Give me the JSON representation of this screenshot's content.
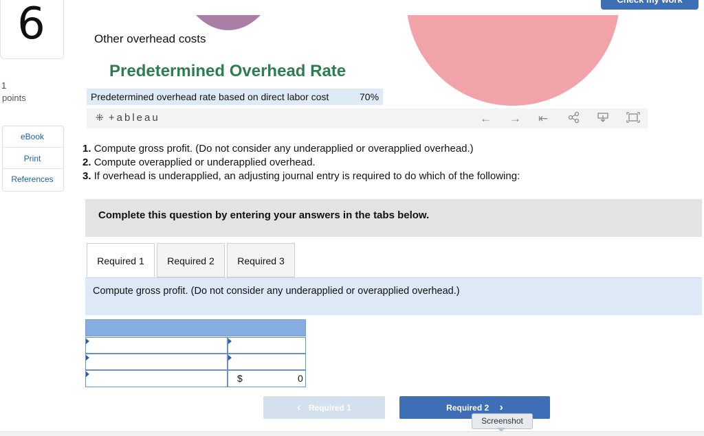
{
  "question": {
    "number": "6",
    "points_value": "1",
    "points_label": "points"
  },
  "sidebar": {
    "items": [
      {
        "label": "eBook"
      },
      {
        "label": "Print"
      },
      {
        "label": "References"
      }
    ]
  },
  "header": {
    "check_button": "Check my work"
  },
  "info": {
    "other_overhead_label": "Other overhead costs",
    "title": "Predetermined Overhead Rate",
    "rate_label": "Predetermined overhead rate based on direct labor cost",
    "rate_value": "70%"
  },
  "tableau": {
    "logo_text": "+ableau",
    "icons": [
      "undo-icon",
      "redo-icon",
      "revert-icon",
      "share-icon",
      "download-icon",
      "fullscreen-icon"
    ]
  },
  "instructions": [
    {
      "num": "1.",
      "text": "Compute gross profit. (Do not consider any underapplied or overapplied overhead.)"
    },
    {
      "num": "2.",
      "text": "Compute overapplied or underapplied overhead."
    },
    {
      "num": "3.",
      "text": "If overhead is underapplied, an adjusting journal entry is required to do which of the following:"
    }
  ],
  "complete_banner": "Complete this question by entering your answers in the tabs below.",
  "tabs": [
    {
      "label": "Required 1",
      "active": true
    },
    {
      "label": "Required 2",
      "active": false
    },
    {
      "label": "Required 3",
      "active": false
    }
  ],
  "tab_panel": {
    "instruction": "Compute gross profit. (Do not consider any underapplied or overapplied overhead.)",
    "rows": [
      {
        "label": "",
        "value": ""
      },
      {
        "label": "",
        "value": ""
      },
      {
        "label": "",
        "currency": "$",
        "value": "0"
      }
    ]
  },
  "nav": {
    "prev_label": "Required 1",
    "next_label": "Required 2",
    "prev_arrow": "‹",
    "next_arrow": "›"
  },
  "tooltip": "Screenshot",
  "colors": {
    "accent": "#3e6fb6",
    "title_green": "#2e7d4f",
    "pink_shape": "#f2a3aa",
    "purple_shape": "#a97fa7"
  }
}
